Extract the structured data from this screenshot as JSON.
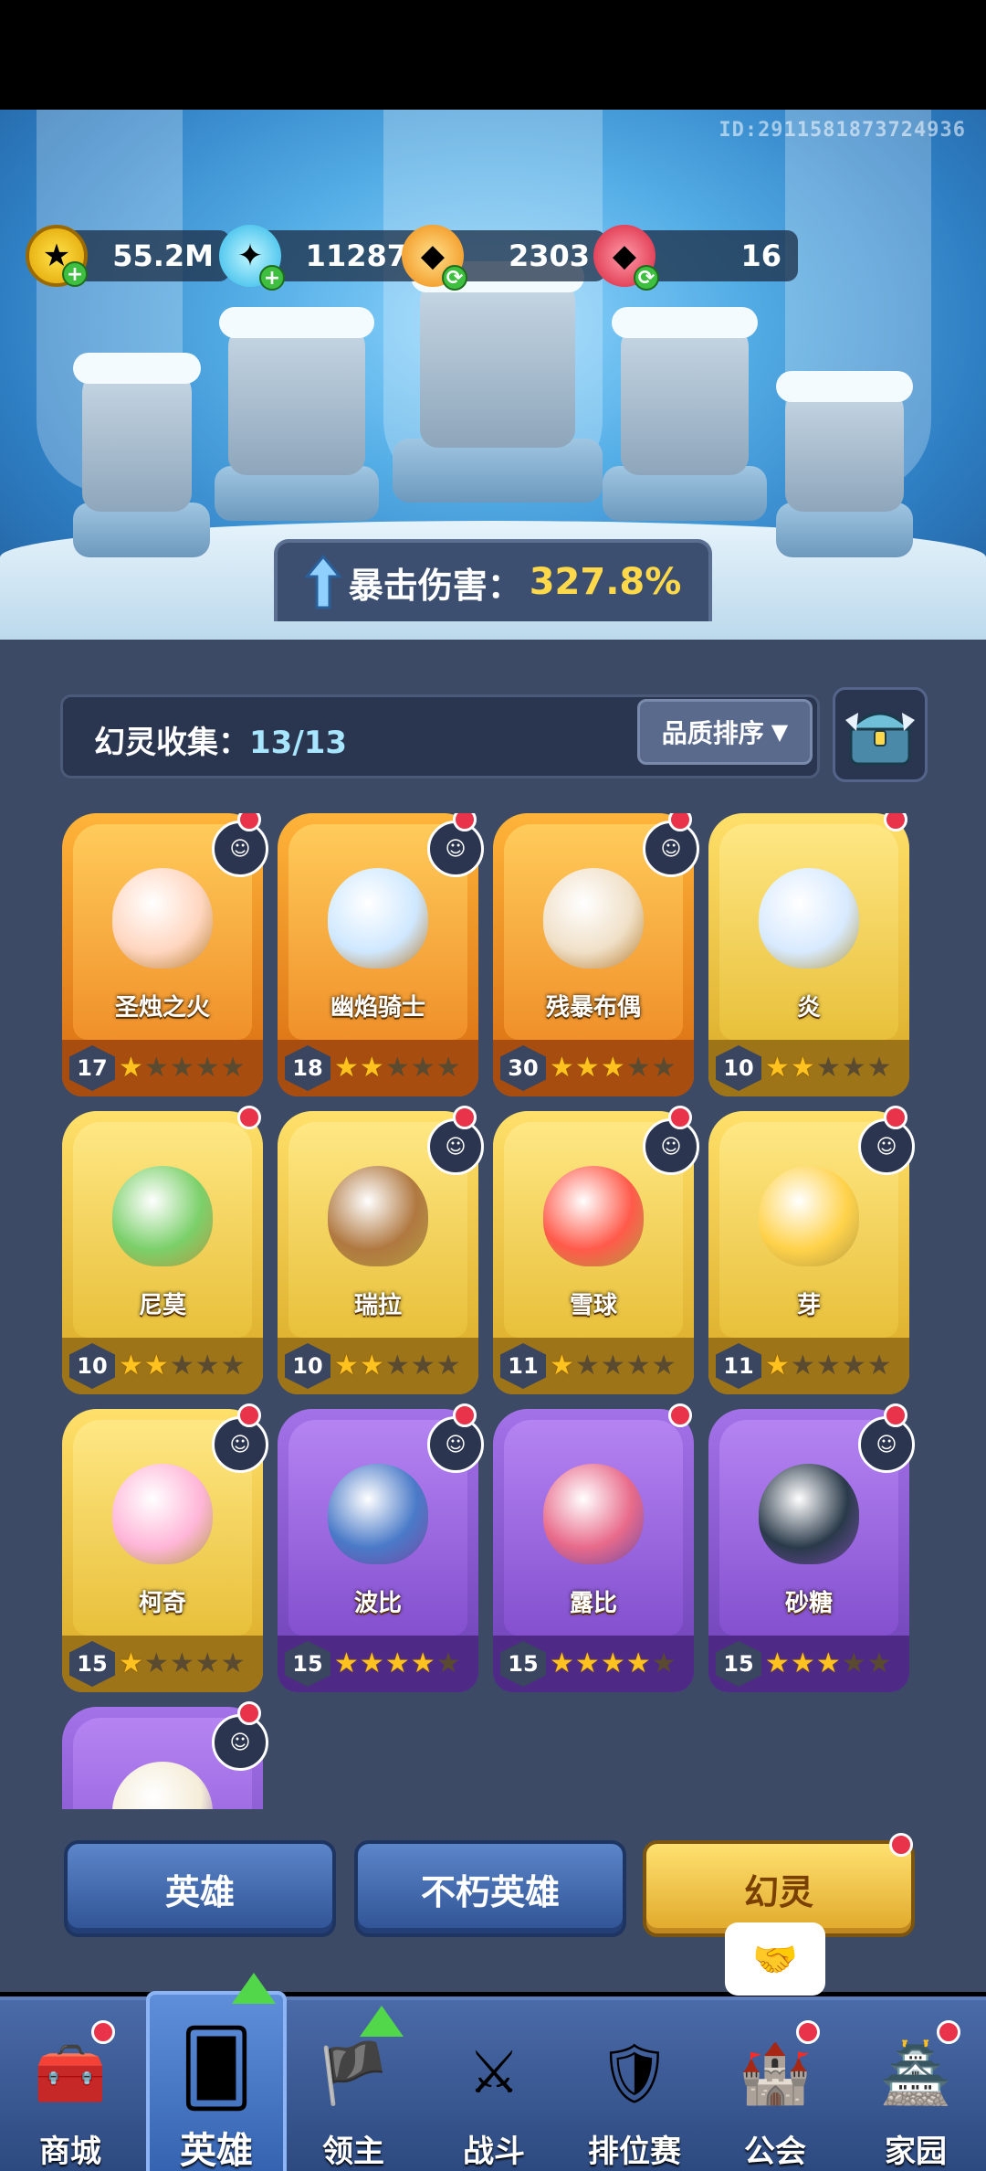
{
  "header": {
    "player_id": "ID:2911581873724936",
    "currencies": [
      {
        "name": "gold-coin",
        "value": "55.2M"
      },
      {
        "name": "blue-crystal",
        "value": "11287"
      },
      {
        "name": "orange-gem",
        "value": "2303"
      },
      {
        "name": "red-gem",
        "value": "16"
      }
    ],
    "crit_label": "暴击伤害：",
    "crit_value": "327.8%"
  },
  "collection": {
    "label": "幻灵收集：",
    "count": "13/13",
    "sort_label": "品质排序"
  },
  "cards": [
    {
      "name": "圣烛之火",
      "level": "17",
      "stars": 1,
      "rarity": "orange"
    },
    {
      "name": "幽焰骑士",
      "level": "18",
      "stars": 2,
      "rarity": "orange"
    },
    {
      "name": "残暴布偶",
      "level": "30",
      "stars": 3,
      "rarity": "orange"
    },
    {
      "name": "炎",
      "level": "10",
      "stars": 2,
      "rarity": "yellow"
    },
    {
      "name": "尼莫",
      "level": "10",
      "stars": 2,
      "rarity": "yellow"
    },
    {
      "name": "瑞拉",
      "level": "10",
      "stars": 2,
      "rarity": "yellow"
    },
    {
      "name": "雪球",
      "level": "11",
      "stars": 1,
      "rarity": "yellow"
    },
    {
      "name": "芽",
      "level": "11",
      "stars": 1,
      "rarity": "yellow"
    },
    {
      "name": "柯奇",
      "level": "15",
      "stars": 1,
      "rarity": "yellow"
    },
    {
      "name": "波比",
      "level": "15",
      "stars": 4,
      "rarity": "purple"
    },
    {
      "name": "露比",
      "level": "15",
      "stars": 4,
      "rarity": "purple"
    },
    {
      "name": "砂糖",
      "level": "15",
      "stars": 3,
      "rarity": "purple"
    },
    {
      "name": "",
      "level": "",
      "stars": 0,
      "rarity": "purple"
    }
  ],
  "tabs": {
    "hero": "英雄",
    "immortal": "不朽英雄",
    "spirit": "幻灵"
  },
  "nav": [
    {
      "label": "商城",
      "icon": "shop-chest-icon"
    },
    {
      "label": "英雄",
      "icon": "hero-card-icon"
    },
    {
      "label": "领主",
      "icon": "lord-banner-icon"
    },
    {
      "label": "战斗",
      "icon": "battle-swords-icon"
    },
    {
      "label": "排位赛",
      "icon": "ranked-shield-icon"
    },
    {
      "label": "公会",
      "icon": "guild-castle-icon"
    },
    {
      "label": "家园",
      "icon": "home-castle-icon"
    }
  ]
}
